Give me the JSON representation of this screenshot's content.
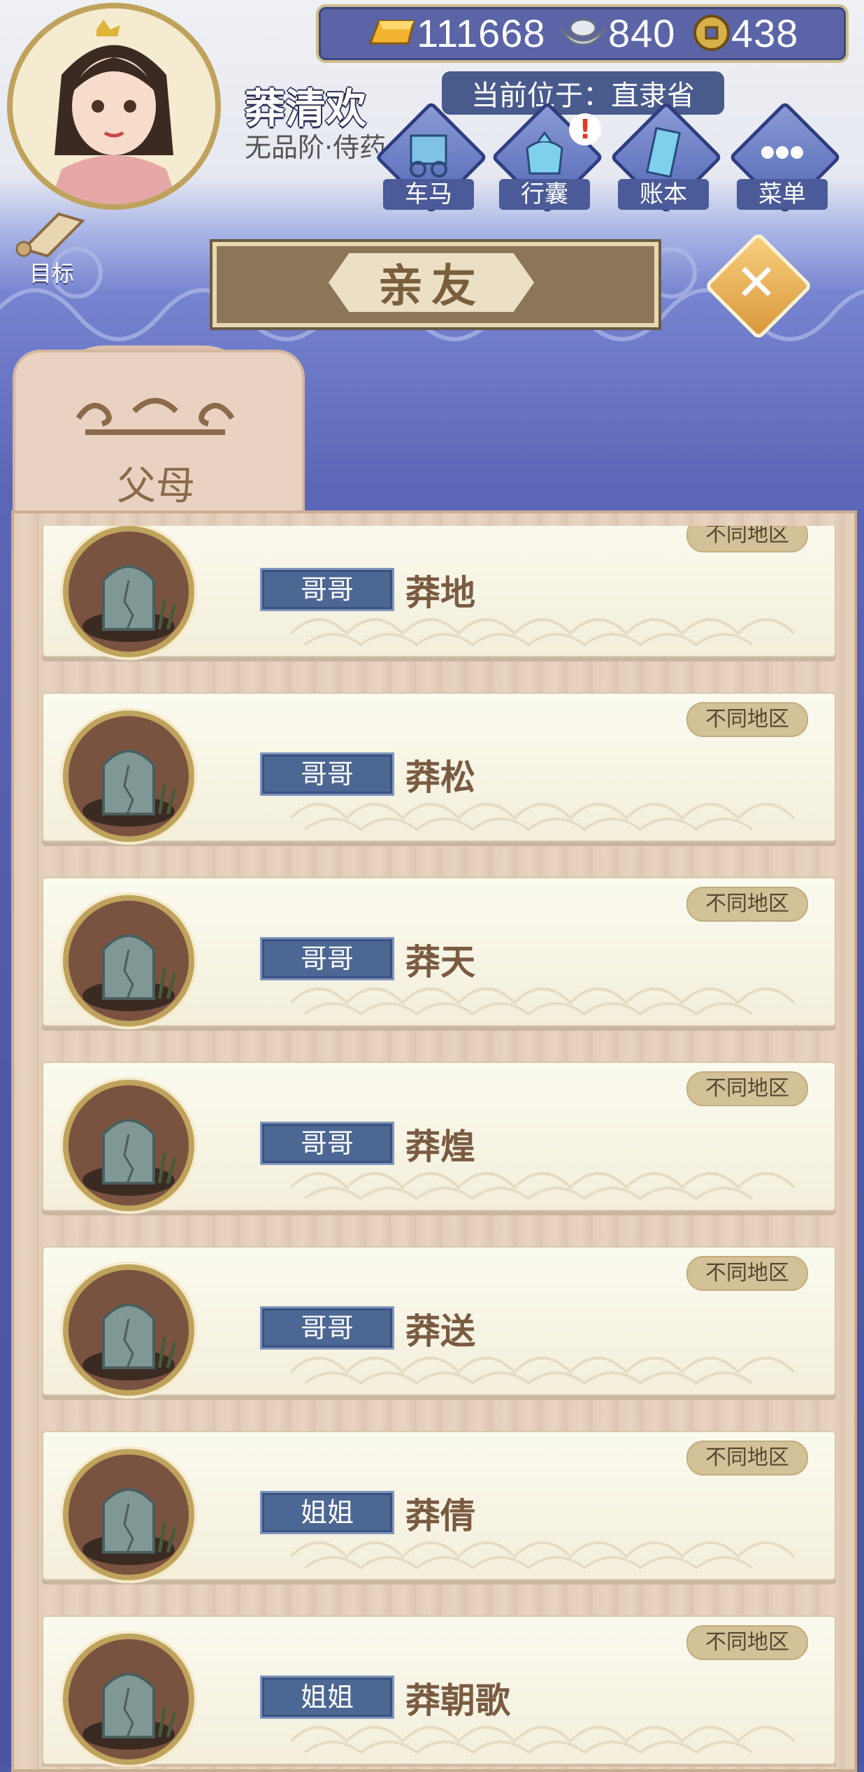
{
  "header": {
    "player_name": "莽清欢",
    "player_rank": "无品阶·侍药",
    "location": "当前位于：直隶省",
    "currencies": [
      {
        "icon": "gold-ingot-icon",
        "value": "111668"
      },
      {
        "icon": "silver-ingot-icon",
        "value": "840"
      },
      {
        "icon": "copper-coin-icon",
        "value": "438"
      }
    ],
    "nav": [
      {
        "name": "carriage",
        "icon": "carriage-icon",
        "label": "车马"
      },
      {
        "name": "luggage",
        "icon": "bundle-icon",
        "label": "行囊",
        "alert": "!"
      },
      {
        "name": "ledger",
        "icon": "book-icon",
        "label": "账本"
      },
      {
        "name": "menu",
        "icon": "more-icon",
        "label": "菜单"
      }
    ],
    "goal_label": "目标"
  },
  "panel": {
    "title": "亲友",
    "close_icon": "close-icon",
    "active_tab": "父母"
  },
  "members": [
    {
      "relation": "哥哥",
      "name": "莽地",
      "region": "不同地区"
    },
    {
      "relation": "哥哥",
      "name": "莽松",
      "region": "不同地区"
    },
    {
      "relation": "哥哥",
      "name": "莽天",
      "region": "不同地区"
    },
    {
      "relation": "哥哥",
      "name": "莽煌",
      "region": "不同地区"
    },
    {
      "relation": "哥哥",
      "name": "莽送",
      "region": "不同地区"
    },
    {
      "relation": "姐姐",
      "name": "莽倩",
      "region": "不同地区"
    },
    {
      "relation": "姐姐",
      "name": "莽朝歌",
      "region": "不同地区"
    }
  ],
  "colors": {
    "sky_dark": "#4e58a6",
    "badge_blue": "#4d6794",
    "frame_gold": "#bfa25c",
    "name_brown": "#7a5b42"
  }
}
